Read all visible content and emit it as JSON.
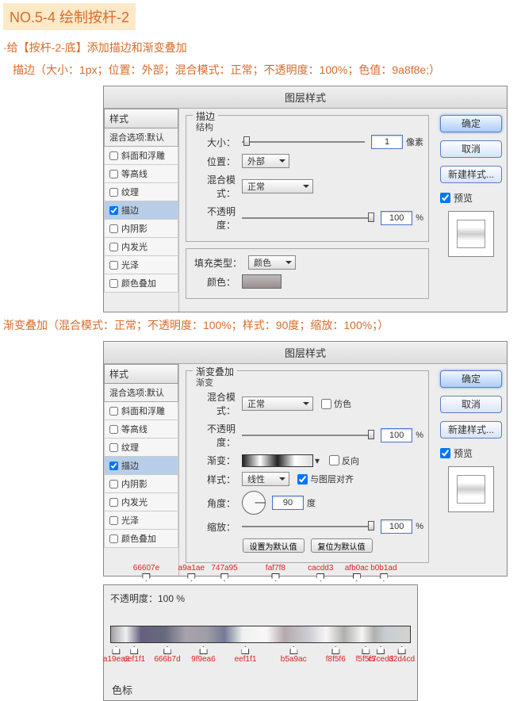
{
  "header": {
    "title": "NO.5-4 绘制按杆-2"
  },
  "instruction": "·给【按杆-2-底】添加描边和渐变叠加",
  "stroke_params": "描边（大小：1px；位置：外部；混合模式：正常；不透明度：100%；色值：9a8f8e;）",
  "grad_params": "渐变叠加（混合模式：正常；不透明度：100%；样式：90度；缩放：100%；）",
  "dialog_title": "图层样式",
  "styles_header": "样式",
  "blend_default": "混合选项:默认",
  "style_items": [
    "斜面和浮雕",
    "等高线",
    "纹理",
    "描边",
    "内阴影",
    "内发光",
    "光泽",
    "颜色叠加"
  ],
  "style_items2": [
    "斜面和浮雕",
    "等高线",
    "纹理",
    "描边",
    "内阴影",
    "内发光",
    "光泽",
    "颜色叠加"
  ],
  "stroke": {
    "legend": "描边",
    "sub": "结构",
    "size_lbl": "大小：",
    "size_val": "1",
    "size_unit": "像素",
    "pos_lbl": "位置：",
    "pos_val": "外部",
    "blend_lbl": "混合模式：",
    "blend_val": "正常",
    "opac_lbl": "不透明度：",
    "opac_val": "100",
    "fill_legend": "填充类型：",
    "fill_val": "颜色",
    "color_lbl": "颜色："
  },
  "grad": {
    "legend": "渐变叠加",
    "sub": "渐变",
    "blend_lbl": "混合模式：",
    "blend_val": "正常",
    "dither_lbl": "仿色",
    "opac_lbl": "不透明度：",
    "opac_val": "100",
    "grad_lbl": "渐变：",
    "reverse_lbl": "反向",
    "style_lbl": "样式：",
    "style_val": "线性",
    "align_lbl": "与图层对齐",
    "angle_lbl": "角度：",
    "angle_val": "90",
    "angle_unit": "度",
    "scale_lbl": "缩放：",
    "scale_val": "100",
    "set_default": "设置为默认值",
    "reset_default": "复位为默认值"
  },
  "buttons": {
    "ok": "确定",
    "cancel": "取消",
    "new_style": "新建样式...",
    "preview": "预览"
  },
  "editor": {
    "opacity_row": "不透明度：100   %",
    "label": "色标",
    "stops_top": [
      {
        "pos": 12,
        "hex": "66607e"
      },
      {
        "pos": 27,
        "hex": "a9a1ae"
      },
      {
        "pos": 38,
        "hex": "747a95"
      },
      {
        "pos": 55,
        "hex": "faf7f8"
      },
      {
        "pos": 70,
        "hex": "cacdd3"
      },
      {
        "pos": 82,
        "hex": "afb0ac"
      },
      {
        "pos": 91,
        "hex": "b0b1ad"
      }
    ],
    "stops_bot": [
      {
        "pos": 2,
        "hex": "a19ea2"
      },
      {
        "pos": 8,
        "hex": "eef1f1"
      },
      {
        "pos": 19,
        "hex": "666b7d"
      },
      {
        "pos": 31,
        "hex": "9f9ea6"
      },
      {
        "pos": 45,
        "hex": "eef1f1"
      },
      {
        "pos": 61,
        "hex": "b5a9ac"
      },
      {
        "pos": 75,
        "hex": "f8f5f6"
      },
      {
        "pos": 85,
        "hex": "f5f5f5"
      },
      {
        "pos": 90,
        "hex": "c7ced3"
      },
      {
        "pos": 97,
        "hex": "d2d4cd"
      }
    ]
  }
}
